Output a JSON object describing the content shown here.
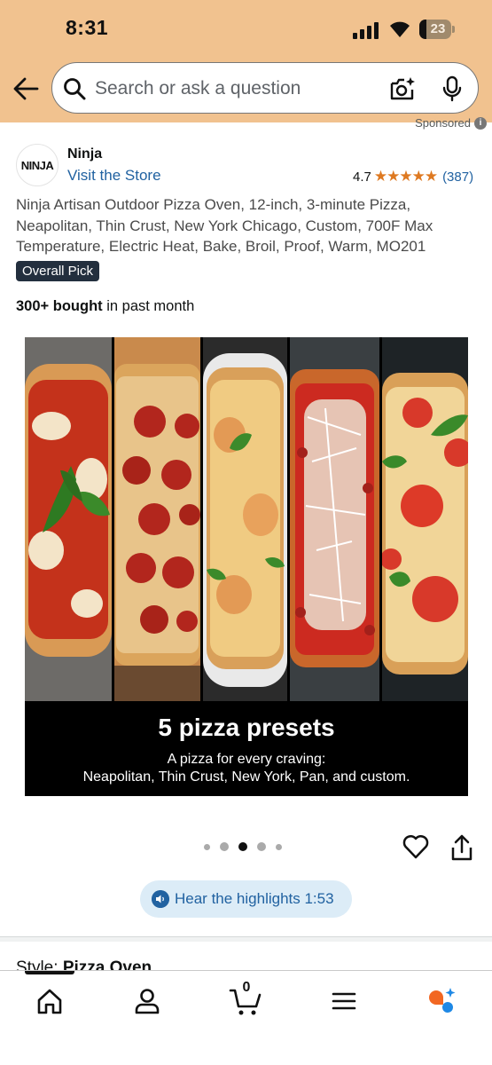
{
  "status_bar": {
    "time": "8:31",
    "battery": "23"
  },
  "search": {
    "placeholder": "Search or ask a question"
  },
  "sponsored": "Sponsored",
  "brand": {
    "logo_text": "NINJA",
    "name": "Ninja",
    "visit_store": "Visit the Store"
  },
  "rating": {
    "value": "4.7",
    "stars": "★★★★★",
    "count": "(387)"
  },
  "product": {
    "title": "Ninja Artisan Outdoor Pizza Oven, 12-inch, 3-minute Pizza, Neapolitan, Thin Crust, New York Chicago, Custom, 700F Max Temperature, Electric Heat, Bake, Broil, Proof, Warm, MO201",
    "badge": "Overall Pick",
    "bought_bold": "300+ bought",
    "bought_rest": " in past month"
  },
  "gallery": {
    "caption_title": "5 pizza presets",
    "caption_line1": "A pizza for every craving:",
    "caption_line2": "Neapolitan, Thin Crust, New York, Pan, and custom.",
    "current_index": 3,
    "total": 5
  },
  "hear_highlights": "Hear the highlights 1:53",
  "style": {
    "label": "Style: ",
    "value": "Pizza Oven"
  },
  "bottom_nav": {
    "cart_count": "0"
  },
  "colors": {
    "header": "#f1c28f",
    "link": "#2162a1",
    "star": "#de7921",
    "badge": "#232f3e"
  }
}
